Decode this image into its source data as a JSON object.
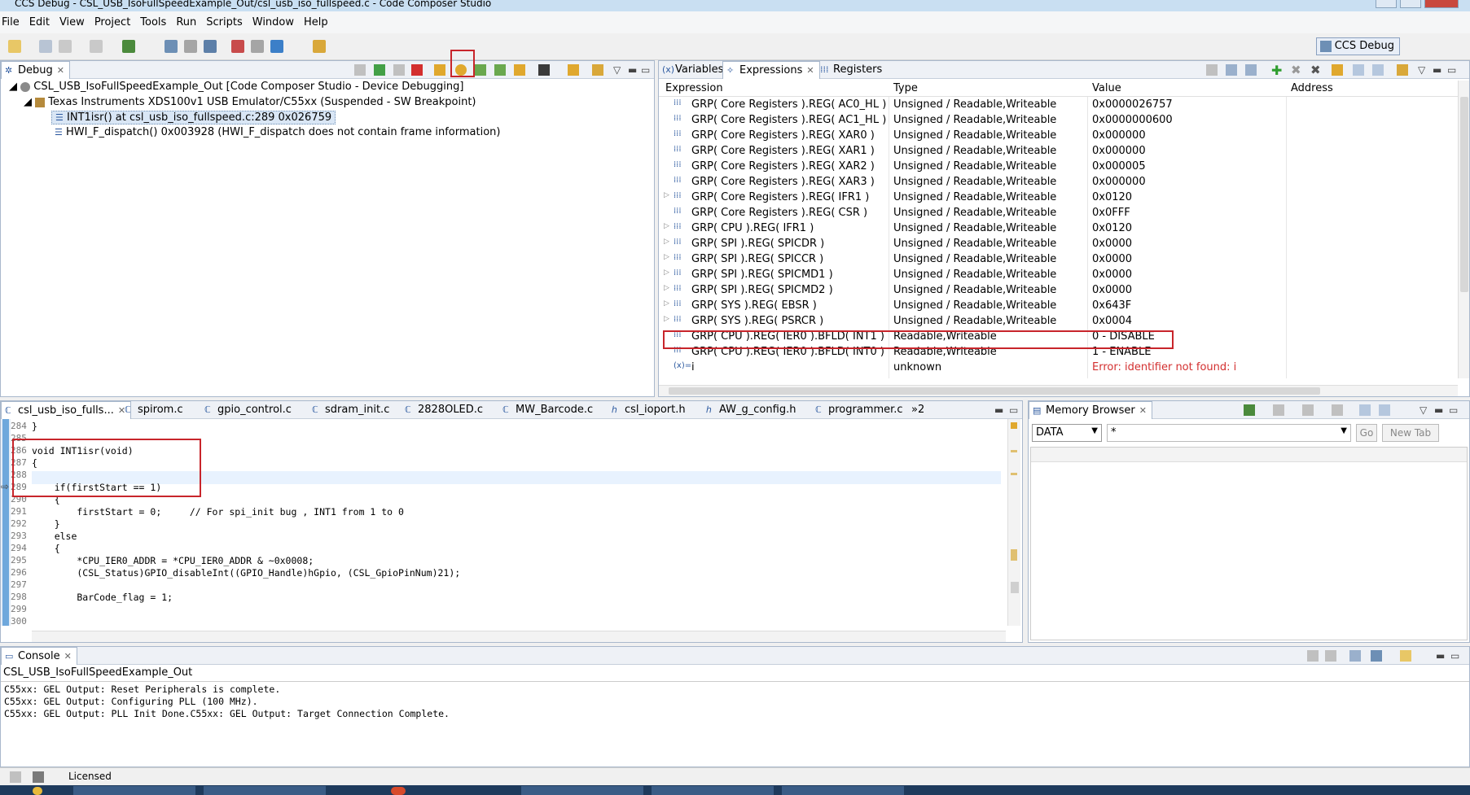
{
  "window": {
    "title": "CCS Debug - CSL_USB_IsoFullSpeedExample_Out/csl_usb_iso_fullspeed.c - Code Composer Studio"
  },
  "menu": [
    "File",
    "Edit",
    "View",
    "Project",
    "Tools",
    "Run",
    "Scripts",
    "Window",
    "Help"
  ],
  "perspective": {
    "label": "CCS Debug"
  },
  "debug_view": {
    "tab": "Debug",
    "tree": [
      "CSL_USB_IsoFullSpeedExample_Out [Code Composer Studio - Device Debugging]",
      "Texas Instruments XDS100v1 USB Emulator/C55xx (Suspended - SW Breakpoint)",
      "INT1isr() at csl_usb_iso_fullspeed.c:289 0x026759",
      "HWI_F_dispatch() 0x003928  (HWI_F_dispatch does not contain frame information)"
    ]
  },
  "expressions_view": {
    "tabs": [
      "Variables",
      "Expressions",
      "Registers"
    ],
    "columns": [
      "Expression",
      "Type",
      "Value",
      "Address"
    ],
    "rows": [
      {
        "expr": "GRP( Core Registers ).REG( AC0_HL )",
        "type": "Unsigned / Readable,Writeable",
        "value": "0x0000026757"
      },
      {
        "expr": "GRP( Core Registers ).REG( AC1_HL )",
        "type": "Unsigned / Readable,Writeable",
        "value": "0x0000000600"
      },
      {
        "expr": "GRP( Core Registers ).REG( XAR0 )",
        "type": "Unsigned / Readable,Writeable",
        "value": "0x000000"
      },
      {
        "expr": "GRP( Core Registers ).REG( XAR1 )",
        "type": "Unsigned / Readable,Writeable",
        "value": "0x000000"
      },
      {
        "expr": "GRP( Core Registers ).REG( XAR2 )",
        "type": "Unsigned / Readable,Writeable",
        "value": "0x000005"
      },
      {
        "expr": "GRP( Core Registers ).REG( XAR3 )",
        "type": "Unsigned / Readable,Writeable",
        "value": "0x000000"
      },
      {
        "expr": "GRP( Core Registers ).REG( IFR1 )",
        "type": "Unsigned / Readable,Writeable",
        "value": "0x0120"
      },
      {
        "expr": "GRP( Core Registers ).REG( CSR )",
        "type": "Unsigned / Readable,Writeable",
        "value": "0x0FFF"
      },
      {
        "expr": "GRP( CPU ).REG( IFR1 )",
        "type": "Unsigned / Readable,Writeable",
        "value": "0x0120"
      },
      {
        "expr": "GRP( SPI ).REG( SPICDR )",
        "type": "Unsigned / Readable,Writeable",
        "value": "0x0000"
      },
      {
        "expr": "GRP( SPI ).REG( SPICCR )",
        "type": "Unsigned / Readable,Writeable",
        "value": "0x0000"
      },
      {
        "expr": "GRP( SPI ).REG( SPICMD1 )",
        "type": "Unsigned / Readable,Writeable",
        "value": "0x0000"
      },
      {
        "expr": "GRP( SPI ).REG( SPICMD2 )",
        "type": "Unsigned / Readable,Writeable",
        "value": "0x0000"
      },
      {
        "expr": "GRP( SYS ).REG( EBSR )",
        "type": "Unsigned / Readable,Writeable",
        "value": "0x643F"
      },
      {
        "expr": "GRP( SYS ).REG( PSRCR )",
        "type": "Unsigned / Readable,Writeable",
        "value": "0x0004"
      },
      {
        "expr": "GRP( CPU ).REG( IER0 ).BFLD( INT1 )",
        "type": "Readable,Writeable",
        "value": "0 - DISABLE"
      },
      {
        "expr": "GRP( CPU ).REG( IER0 ).BFLD( INT0 )",
        "type": "Readable,Writeable",
        "value": "1 - ENABLE"
      },
      {
        "expr": "i",
        "type": "unknown",
        "value": "Error: identifier not found: i"
      }
    ]
  },
  "editor": {
    "tabs": [
      "csl_usb_iso_fulls...",
      "spirom.c",
      "gpio_control.c",
      "sdram_init.c",
      "2828OLED.c",
      "MW_Barcode.c",
      "csl_ioport.h",
      "AW_g_config.h",
      "programmer.c",
      "»2"
    ],
    "line_numbers": [
      "284",
      "285",
      "286",
      "287",
      "288",
      "289",
      "290",
      "291",
      "292",
      "293",
      "294",
      "295",
      "296",
      "297",
      "298",
      "299",
      "300"
    ],
    "lines": [
      "}",
      "",
      "void INT1isr(void)",
      "{",
      "",
      "    if(firstStart == 1)",
      "    {",
      "        firstStart = 0;     // For spi_init bug , INT1 from 1 to 0",
      "    }",
      "    else",
      "    {",
      "        *CPU_IER0_ADDR = *CPU_IER0_ADDR & ~0x0008;",
      "        (CSL_Status)GPIO_disableInt((GPIO_Handle)hGpio, (CSL_GpioPinNum)21);",
      "",
      "        BarCode_flag = 1;",
      "",
      ""
    ]
  },
  "memory_browser": {
    "tab": "Memory Browser",
    "page": "DATA",
    "address_value": "*",
    "go_label": "Go",
    "new_tab_label": "New Tab"
  },
  "console": {
    "tab": "Console",
    "title": "CSL_USB_IsoFullSpeedExample_Out",
    "lines": [
      "C55xx: GEL Output: Reset Peripherals is complete.",
      "C55xx: GEL Output: Configuring PLL (100 MHz).",
      "C55xx: GEL Output: PLL Init Done.C55xx: GEL Output: Target Connection Complete."
    ]
  },
  "status": {
    "license": "Licensed"
  },
  "colors": {
    "highlight": "#c8252b",
    "accent": "#2d5aa0"
  }
}
